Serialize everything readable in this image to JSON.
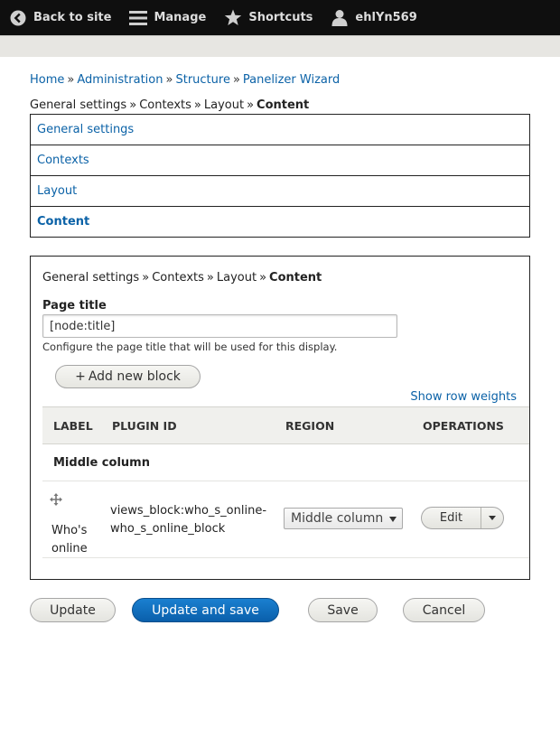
{
  "toolbar": {
    "back_label": "Back to site",
    "manage_label": "Manage",
    "shortcuts_label": "Shortcuts",
    "user_label": "ehlYn569"
  },
  "breadcrumb": {
    "items": [
      "Home",
      "Administration",
      "Structure",
      "Panelizer Wizard"
    ],
    "separator": "»"
  },
  "wizard_trail": {
    "steps": [
      "General settings",
      "Contexts",
      "Layout"
    ],
    "current": "Content"
  },
  "vertical_tabs": [
    "General settings",
    "Contexts",
    "Layout",
    "Content"
  ],
  "panel": {
    "page_title_label": "Page title",
    "page_title_value": "[node:title]",
    "page_title_description": "Configure the page title that will be used for this display.",
    "add_block_label": "Add new block",
    "row_weights_label": "Show row weights",
    "table": {
      "headers": [
        "LABEL",
        "PLUGIN ID",
        "REGION",
        "OPERATIONS"
      ],
      "group": "Middle column",
      "rows": [
        {
          "label_line1": "Who's",
          "label_line2": "online",
          "plugin_line1": "views_block:who_s_online-",
          "plugin_line2": "who_s_online_block",
          "region": "Middle column",
          "operation": "Edit"
        }
      ]
    }
  },
  "actions": {
    "update": "Update",
    "update_and_save": "Update and save",
    "save": "Save",
    "cancel": "Cancel"
  },
  "colors": {
    "link": "#0b62a7",
    "primary_button": "#0a5fab",
    "toolbar_bg": "#0f0f0f"
  }
}
